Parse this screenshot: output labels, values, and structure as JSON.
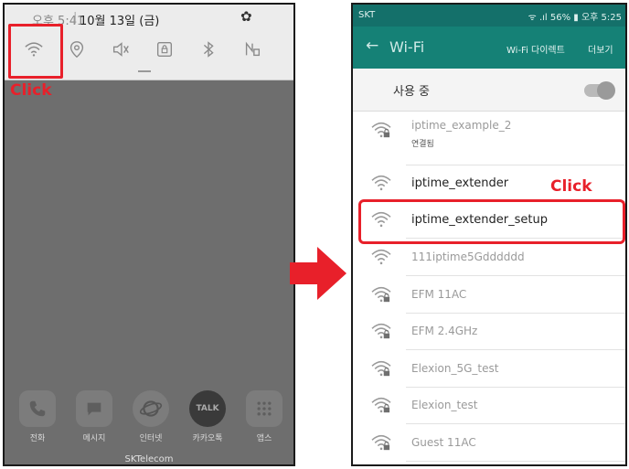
{
  "left_phone": {
    "status": {
      "time": "오후 5:41",
      "separator": "|",
      "date": "10월 13일 (금)"
    },
    "quick_settings": [
      "wifi-icon",
      "location-icon",
      "mute-icon",
      "rotation-lock-icon",
      "bluetooth-icon",
      "nfc-icon"
    ],
    "annotation": {
      "click_label": "Click"
    },
    "dock_apps": [
      {
        "label": "전화",
        "icon": "phone-icon"
      },
      {
        "label": "메시지",
        "icon": "message-icon"
      },
      {
        "label": "인터넷",
        "icon": "internet-icon"
      },
      {
        "label": "카카오톡",
        "icon": "kakaotalk-icon",
        "icon_text": "TALK"
      },
      {
        "label": "앱스",
        "icon": "apps-grid-icon"
      }
    ],
    "carrier": "SKTelecom"
  },
  "right_phone": {
    "status": {
      "carrier": "SKT",
      "right": "ᯤ .ıl 56% ▮ 오후 5:25"
    },
    "appbar": {
      "back": "←",
      "title": "Wi-Fi",
      "wifi_direct": "Wi-Fi 다이렉트",
      "more": "더보기"
    },
    "in_use": {
      "label": "사용 중",
      "toggle": "on"
    },
    "networks": [
      {
        "name": "iptime_example_2",
        "subtitle": "연결됨",
        "secured": true
      },
      {
        "name": "iptime_extender",
        "secured": false
      },
      {
        "name": "iptime_extender_setup",
        "secured": false
      },
      {
        "name": "111iptime5Gdddddd",
        "secured": false
      },
      {
        "name": "EFM 11AC",
        "secured": true
      },
      {
        "name": "EFM 2.4GHz",
        "secured": true
      },
      {
        "name": "Elexion_5G_test",
        "secured": true
      },
      {
        "name": "Elexion_test",
        "secured": true
      },
      {
        "name": "Guest 11AC",
        "secured": true
      }
    ],
    "annotation": {
      "click_label": "Click"
    }
  },
  "colors": {
    "accent": "#158176",
    "highlight": "#e8202a"
  }
}
